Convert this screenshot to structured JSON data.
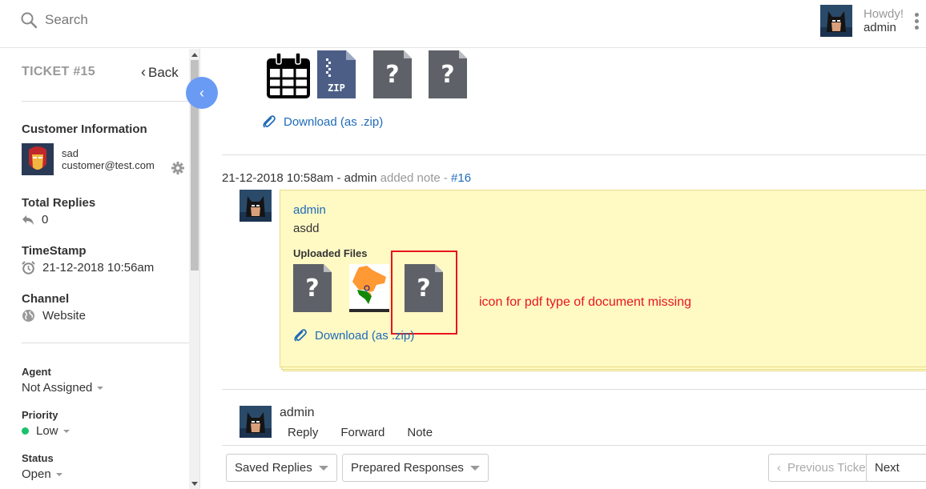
{
  "search": {
    "placeholder": "Search"
  },
  "user": {
    "greeting": "Howdy!",
    "name": "admin"
  },
  "ticket": {
    "title": "TICKET #15",
    "back_label": "Back"
  },
  "customer_info": {
    "title": "Customer Information",
    "name": "sad",
    "email": "customer@test.com"
  },
  "total_replies": {
    "title": "Total Replies",
    "value": "0"
  },
  "timestamp": {
    "title": "TimeStamp",
    "value": "21-12-2018 10:56am"
  },
  "channel": {
    "title": "Channel",
    "value": "Website"
  },
  "agent": {
    "title": "Agent",
    "value": "Not Assigned"
  },
  "priority": {
    "title": "Priority",
    "value": "Low",
    "color": "#19c26b"
  },
  "status": {
    "title": "Status",
    "value": "Open"
  },
  "top_attachments": {
    "icons": [
      "calendar-icon",
      "zip-file-icon",
      "unknown-file-icon",
      "unknown-file-icon"
    ],
    "download_label": "Download (as .zip)"
  },
  "note": {
    "timestamp": "21-12-2018 10:58am",
    "author_prefix": " - admin",
    "action": " added note - ",
    "ref": "#16",
    "author": "admin",
    "text": "asdd",
    "uploaded_title": "Uploaded Files",
    "download_label": "Download (as .zip)",
    "annotation": "icon for pdf type of document missing"
  },
  "reply": {
    "author": "admin",
    "tabs": [
      "Reply",
      "Forward",
      "Note"
    ]
  },
  "footer": {
    "saved_replies": "Saved Replies",
    "prepared_responses": "Prepared Responses",
    "previous_ticket": "Previous Ticket",
    "next": "Next"
  },
  "colors": {
    "link": "#1e6bb8",
    "collapse": "#6a9bf4",
    "note_bg": "#fff9c4",
    "annotation": "#e8151b"
  }
}
